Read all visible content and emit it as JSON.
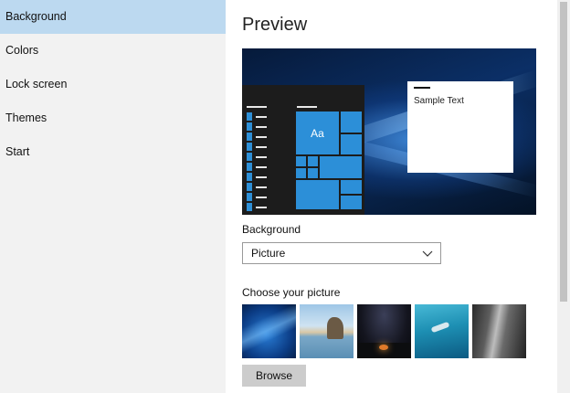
{
  "sidebar": {
    "items": [
      {
        "label": "Background",
        "active": true
      },
      {
        "label": "Colors",
        "active": false
      },
      {
        "label": "Lock screen",
        "active": false
      },
      {
        "label": "Themes",
        "active": false
      },
      {
        "label": "Start",
        "active": false
      }
    ]
  },
  "main": {
    "preview_title": "Preview",
    "preview": {
      "tile_label": "Aa",
      "window_text": "Sample Text"
    },
    "background_label": "Background",
    "background_select": {
      "value": "Picture"
    },
    "choose_label": "Choose your picture",
    "pictures": [
      "windows-blue-light",
      "beach-rock-arch",
      "night-sky-tent",
      "underwater-swimmer",
      "rock-cliff-grayscale"
    ],
    "browse_label": "Browse"
  },
  "colors": {
    "accent": "#2c8fd8",
    "active_nav": "#bcd9f0",
    "sidebar_bg": "#f2f2f2"
  }
}
